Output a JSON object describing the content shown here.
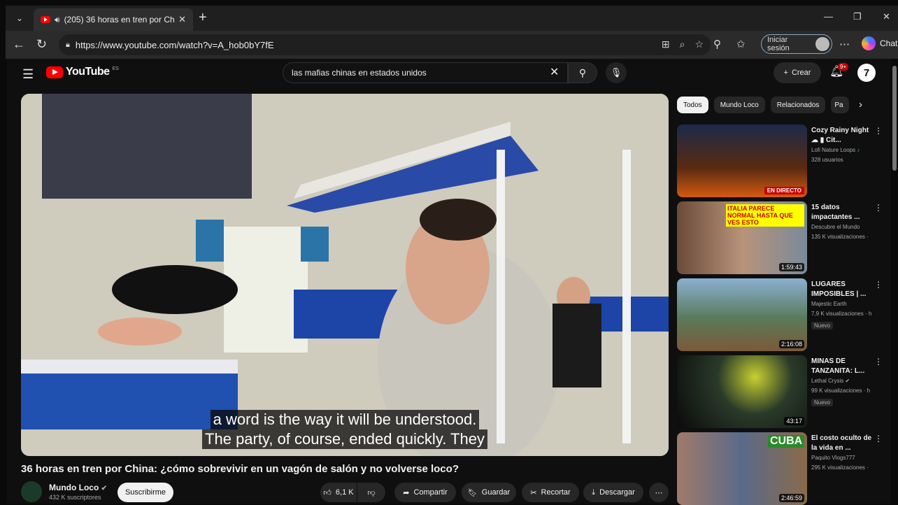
{
  "browser": {
    "tab_title": "(205) 36 horas en tren por Ch",
    "url": "https://www.youtube.com/watch?v=A_hob0bY7fE",
    "signin_label": "Iniciar sesión",
    "chat_label": "Chat"
  },
  "youtube": {
    "logo_text": "YouTube",
    "logo_region": "ES",
    "search_value": "las mafias chinas en estados unidos",
    "create_label": "Crear",
    "notifications_count": "9+"
  },
  "video": {
    "subtitle_line1": "a word is the way it will be understood.",
    "subtitle_line2": "The party, of course, ended quickly.   They",
    "title": "36 horas en tren por China: ¿cómo sobrevivir en un vagón de salón y no volverse loco?",
    "channel_name": "Mundo Loco",
    "channel_subs": "432 K suscriptores",
    "subscribe_label": "Suscribirme",
    "likes": "6,1 K",
    "share_label": "Compartir",
    "save_label": "Guardar",
    "clip_label": "Recortar",
    "download_label": "Descargar"
  },
  "chips": [
    "Todos",
    "Mundo Loco",
    "Relacionados",
    "Pa"
  ],
  "recommendations": [
    {
      "title": "Cozy Rainy Night ☁ ▮ Cit...",
      "channel": "Lofi Nature Loops",
      "meta": "328 usuarios",
      "badge": "EN DIRECTO",
      "caption": ""
    },
    {
      "title": "15 datos impactantes ...",
      "channel": "Descubre el Mundo",
      "meta": "135 K visualizaciones ·",
      "badge": "1:59:43",
      "caption": "ITALIA PARECE NORMAL HASTA QUE VES ESTO"
    },
    {
      "title": "LUGARES IMPOSIBLES | ...",
      "channel": "Majestic Earth",
      "meta": "7,9 K visualizaciones · h",
      "badge": "2:16:08",
      "caption": "",
      "new": "Nuevo"
    },
    {
      "title": "MINAS DE TANZANITA: L...",
      "channel": "Lethal Crysis",
      "meta": "99 K visualizaciones · h",
      "badge": "43:17",
      "caption": "",
      "new": "Nuevo"
    },
    {
      "title": "El costo oculto de la vida en ...",
      "channel": "Paquito Vlogs777",
      "meta": "295 K visualizaciones ·",
      "badge": "2:46:59",
      "caption": "CUBA"
    }
  ]
}
